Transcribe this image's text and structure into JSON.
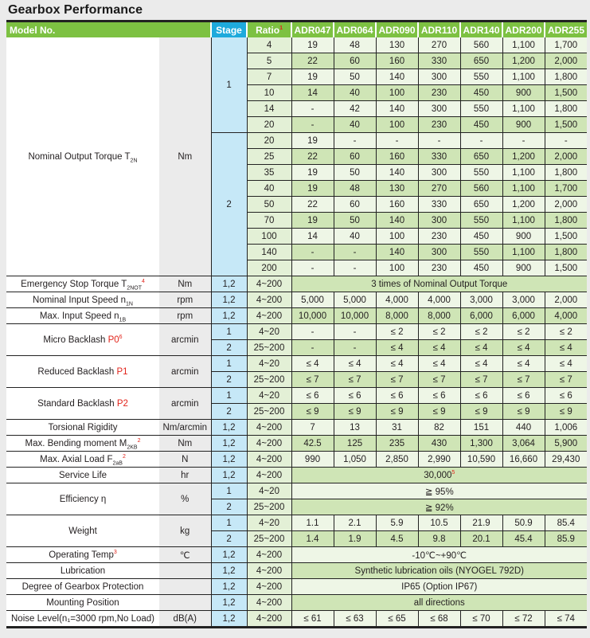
{
  "title": "Gearbox Performance",
  "header": {
    "model_no": "Model No.",
    "stage": "Stage",
    "ratio": "Ratio",
    "ratio_fn": "1",
    "models": [
      "ADR047",
      "ADR064",
      "ADR090",
      "ADR110",
      "ADR140",
      "ADR200",
      "ADR255"
    ]
  },
  "nominal_torque": {
    "param": "Nominal Output Torque T",
    "param_sub": "2N",
    "unit": "Nm",
    "stage1": {
      "stage": "1",
      "rows": [
        {
          "ratio": "4",
          "values": [
            "19",
            "48",
            "130",
            "270",
            "560",
            "1,100",
            "1,700"
          ]
        },
        {
          "ratio": "5",
          "values": [
            "22",
            "60",
            "160",
            "330",
            "650",
            "1,200",
            "2,000"
          ]
        },
        {
          "ratio": "7",
          "values": [
            "19",
            "50",
            "140",
            "300",
            "550",
            "1,100",
            "1,800"
          ]
        },
        {
          "ratio": "10",
          "values": [
            "14",
            "40",
            "100",
            "230",
            "450",
            "900",
            "1,500"
          ]
        },
        {
          "ratio": "14",
          "values": [
            "-",
            "42",
            "140",
            "300",
            "550",
            "1,100",
            "1,800"
          ]
        },
        {
          "ratio": "20",
          "values": [
            "-",
            "40",
            "100",
            "230",
            "450",
            "900",
            "1,500"
          ]
        }
      ]
    },
    "stage2": {
      "stage": "2",
      "rows": [
        {
          "ratio": "20",
          "values": [
            "19",
            "-",
            "-",
            "-",
            "-",
            "-",
            "-"
          ]
        },
        {
          "ratio": "25",
          "values": [
            "22",
            "60",
            "160",
            "330",
            "650",
            "1,200",
            "2,000"
          ]
        },
        {
          "ratio": "35",
          "values": [
            "19",
            "50",
            "140",
            "300",
            "550",
            "1,100",
            "1,800"
          ]
        },
        {
          "ratio": "40",
          "values": [
            "19",
            "48",
            "130",
            "270",
            "560",
            "1,100",
            "1,700"
          ]
        },
        {
          "ratio": "50",
          "values": [
            "22",
            "60",
            "160",
            "330",
            "650",
            "1,200",
            "2,000"
          ]
        },
        {
          "ratio": "70",
          "values": [
            "19",
            "50",
            "140",
            "300",
            "550",
            "1,100",
            "1,800"
          ]
        },
        {
          "ratio": "100",
          "values": [
            "14",
            "40",
            "100",
            "230",
            "450",
            "900",
            "1,500"
          ]
        },
        {
          "ratio": "140",
          "values": [
            "-",
            "-",
            "140",
            "300",
            "550",
            "1,100",
            "1,800"
          ]
        },
        {
          "ratio": "200",
          "values": [
            "-",
            "-",
            "100",
            "230",
            "450",
            "900",
            "1,500"
          ]
        }
      ]
    }
  },
  "emergency": {
    "param": "Emergency Stop Torque T",
    "param_sub": "2NOT",
    "fn": "4",
    "unit": "Nm",
    "stage": "1,2",
    "ratio": "4~200",
    "value": "3 times of Nominal Output Torque"
  },
  "nominal_speed": {
    "param": "Nominal Input Speed n",
    "param_sub": "1N",
    "unit": "rpm",
    "stage": "1,2",
    "ratio": "4~200",
    "values": [
      "5,000",
      "5,000",
      "4,000",
      "4,000",
      "3,000",
      "3,000",
      "2,000"
    ]
  },
  "max_speed": {
    "param": "Max. Input Speed n",
    "param_sub": "1B",
    "unit": "rpm",
    "stage": "1,2",
    "ratio": "4~200",
    "values": [
      "10,000",
      "10,000",
      "8,000",
      "8,000",
      "6,000",
      "6,000",
      "4,000"
    ]
  },
  "micro_backlash": {
    "param": "Micro Backlash ",
    "param_red": "P0",
    "fn": "6",
    "unit": "arcmin",
    "rows": [
      {
        "stage": "1",
        "ratio": "4~20",
        "values": [
          "-",
          "-",
          "≤ 2",
          "≤ 2",
          "≤ 2",
          "≤ 2",
          "≤ 2"
        ]
      },
      {
        "stage": "2",
        "ratio": "25~200",
        "values": [
          "-",
          "-",
          "≤ 4",
          "≤ 4",
          "≤ 4",
          "≤ 4",
          "≤ 4"
        ]
      }
    ]
  },
  "reduced_backlash": {
    "param": "Reduced Backlash ",
    "param_red": "P1",
    "unit": "arcmin",
    "rows": [
      {
        "stage": "1",
        "ratio": "4~20",
        "values": [
          "≤ 4",
          "≤ 4",
          "≤ 4",
          "≤ 4",
          "≤ 4",
          "≤ 4",
          "≤ 4"
        ]
      },
      {
        "stage": "2",
        "ratio": "25~200",
        "values": [
          "≤ 7",
          "≤ 7",
          "≤ 7",
          "≤ 7",
          "≤ 7",
          "≤ 7",
          "≤ 7"
        ]
      }
    ]
  },
  "standard_backlash": {
    "param": "Standard Backlash ",
    "param_red": "P2",
    "unit": "arcmin",
    "rows": [
      {
        "stage": "1",
        "ratio": "4~20",
        "values": [
          "≤ 6",
          "≤ 6",
          "≤ 6",
          "≤ 6",
          "≤ 6",
          "≤ 6",
          "≤ 6"
        ]
      },
      {
        "stage": "2",
        "ratio": "25~200",
        "values": [
          "≤ 9",
          "≤ 9",
          "≤ 9",
          "≤ 9",
          "≤ 9",
          "≤ 9",
          "≤ 9"
        ]
      }
    ]
  },
  "torsional": {
    "param": "Torsional Rigidity",
    "unit": "Nm/arcmin",
    "stage": "1,2",
    "ratio": "4~200",
    "values": [
      "7",
      "13",
      "31",
      "82",
      "151",
      "440",
      "1,006"
    ]
  },
  "bending": {
    "param": "Max. Bending moment M",
    "param_sub": "2KB",
    "fn": "2",
    "unit": "Nm",
    "stage": "1,2",
    "ratio": "4~200",
    "values": [
      "42.5",
      "125",
      "235",
      "430",
      "1,300",
      "3,064",
      "5,900"
    ]
  },
  "axial": {
    "param": "Max. Axial Load  F",
    "param_sub": "2aB",
    "fn": "2",
    "unit": "N",
    "stage": "1,2",
    "ratio": "4~200",
    "values": [
      "990",
      "1,050",
      "2,850",
      "2,990",
      "10,590",
      "16,660",
      "29,430"
    ]
  },
  "service": {
    "param": "Service Life",
    "unit": "hr",
    "stage": "1,2",
    "ratio": "4~200",
    "value": "30,000",
    "fn": "5"
  },
  "efficiency": {
    "param": "Efficiency η",
    "unit": "%",
    "rows": [
      {
        "stage": "1",
        "ratio": "4~20",
        "value": "≧ 95%"
      },
      {
        "stage": "2",
        "ratio": "25~200",
        "value": "≧ 92%"
      }
    ]
  },
  "weight": {
    "param": "Weight",
    "unit": "kg",
    "rows": [
      {
        "stage": "1",
        "ratio": "4~20",
        "values": [
          "1.1",
          "2.1",
          "5.9",
          "10.5",
          "21.9",
          "50.9",
          "85.4"
        ]
      },
      {
        "stage": "2",
        "ratio": "25~200",
        "values": [
          "1.4",
          "1.9",
          "4.5",
          "9.8",
          "20.1",
          "45.4",
          "85.9"
        ]
      }
    ]
  },
  "temp": {
    "param": "Operating Temp",
    "fn": "3",
    "unit": "℃",
    "stage": "1,2",
    "ratio": "4~200",
    "value": "-10℃~+90℃"
  },
  "lubrication": {
    "param": "Lubrication",
    "unit": "",
    "stage": "1,2",
    "ratio": "4~200",
    "value": "Synthetic lubrication oils (NYOGEL 792D)"
  },
  "protection": {
    "param": "Degree of Gearbox Protection",
    "unit": "",
    "stage": "1,2",
    "ratio": "4~200",
    "value": "IP65 (Option IP67)"
  },
  "mounting": {
    "param": "Mounting Position",
    "unit": "",
    "stage": "1,2",
    "ratio": "4~200",
    "value": "all directions"
  },
  "noise": {
    "param": "Noise Level(n₁=3000 rpm,No Load)",
    "unit": "dB(A)",
    "stage": "1,2",
    "ratio": "4~200",
    "values": [
      "≤ 61",
      "≤ 63",
      "≤ 65",
      "≤ 68",
      "≤ 70",
      "≤ 72",
      "≤ 74"
    ]
  }
}
